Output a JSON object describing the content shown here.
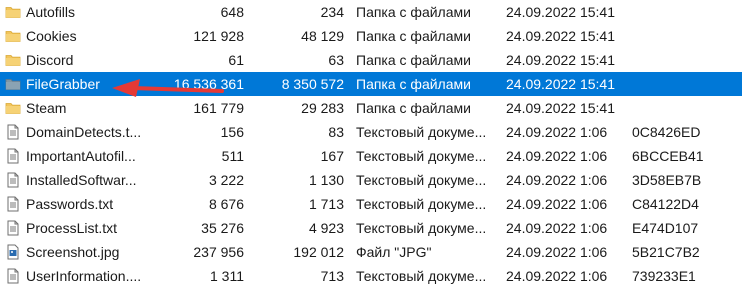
{
  "files": [
    {
      "icon": "folder-icon",
      "name": "Autofills",
      "size": "648",
      "packed": "234",
      "type": "Папка с файлами",
      "modified": "24.09.2022 15:41",
      "crc": ""
    },
    {
      "icon": "folder-icon",
      "name": "Cookies",
      "size": "121 928",
      "packed": "48 129",
      "type": "Папка с файлами",
      "modified": "24.09.2022 15:41",
      "crc": ""
    },
    {
      "icon": "folder-icon",
      "name": "Discord",
      "size": "61",
      "packed": "63",
      "type": "Папка с файлами",
      "modified": "24.09.2022 15:41",
      "crc": ""
    },
    {
      "icon": "folder-icon",
      "name": "FileGrabber",
      "size": "16 536 361",
      "packed": "8 350 572",
      "type": "Папка с файлами",
      "modified": "24.09.2022 15:41",
      "crc": "",
      "selected": true
    },
    {
      "icon": "folder-icon",
      "name": "Steam",
      "size": "161 779",
      "packed": "29 283",
      "type": "Папка с файлами",
      "modified": "24.09.2022 15:41",
      "crc": ""
    },
    {
      "icon": "text-file-icon",
      "name": "DomainDetects.t...",
      "size": "156",
      "packed": "83",
      "type": "Текстовый докуме...",
      "modified": "24.09.2022 1:06",
      "crc": "0C8426ED"
    },
    {
      "icon": "text-file-icon",
      "name": "ImportantAutofil...",
      "size": "511",
      "packed": "167",
      "type": "Текстовый докуме...",
      "modified": "24.09.2022 1:06",
      "crc": "6BCCEB41"
    },
    {
      "icon": "text-file-icon",
      "name": "InstalledSoftwar...",
      "size": "3 222",
      "packed": "1 130",
      "type": "Текстовый докуме...",
      "modified": "24.09.2022 1:06",
      "crc": "3D58EB7B"
    },
    {
      "icon": "text-file-icon",
      "name": "Passwords.txt",
      "size": "8 676",
      "packed": "1 713",
      "type": "Текстовый докуме...",
      "modified": "24.09.2022 1:06",
      "crc": "C84122D4"
    },
    {
      "icon": "text-file-icon",
      "name": "ProcessList.txt",
      "size": "35 276",
      "packed": "4 923",
      "type": "Текстовый докуме...",
      "modified": "24.09.2022 1:06",
      "crc": "E474D107"
    },
    {
      "icon": "image-file-icon",
      "name": "Screenshot.jpg",
      "size": "237 956",
      "packed": "192 012",
      "type": "Файл \"JPG\"",
      "modified": "24.09.2022 1:06",
      "crc": "5B21C7B2"
    },
    {
      "icon": "text-file-icon",
      "name": "UserInformation....",
      "size": "1 311",
      "packed": "713",
      "type": "Текстовый докуме...",
      "modified": "24.09.2022 1:06",
      "crc": "739233E1"
    }
  ],
  "colors": {
    "selection": "#0078d7",
    "folder": "#f2c55c",
    "arrow": "#e53935"
  }
}
